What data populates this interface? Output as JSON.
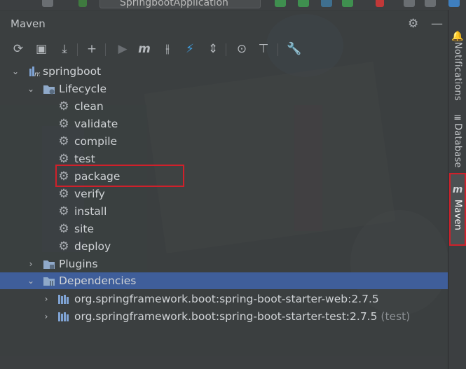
{
  "top_bar": {
    "run_config_label": "SpringbootApplication"
  },
  "panel": {
    "title": "Maven"
  },
  "toolbar": {
    "items": [
      {
        "name": "reload-all-maven-projects",
        "icon": "refresh-icon"
      },
      {
        "name": "generate-sources",
        "icon": "folder-refresh-icon"
      },
      {
        "name": "download-sources",
        "icon": "download-icon"
      },
      {
        "name": "add-maven-project",
        "icon": "plus-icon"
      },
      {
        "name": "run-maven-build",
        "icon": "run-icon"
      },
      {
        "name": "execute-maven-goal",
        "icon": "maven-m-icon"
      },
      {
        "name": "toggle-offline-mode",
        "icon": "offline-icon"
      },
      {
        "name": "skip-tests",
        "icon": "lightning-icon"
      },
      {
        "name": "collapse-all",
        "icon": "collapse-icon"
      },
      {
        "name": "analyze-dependencies",
        "icon": "analyze-icon"
      },
      {
        "name": "show-dependencies",
        "icon": "diagram-icon"
      },
      {
        "name": "maven-settings",
        "icon": "wrench-icon"
      }
    ]
  },
  "tree": {
    "project": "springboot",
    "lifecycle": {
      "label": "Lifecycle",
      "goals": [
        "clean",
        "validate",
        "compile",
        "test",
        "package",
        "verify",
        "install",
        "site",
        "deploy"
      ]
    },
    "plugins": "Plugins",
    "dependencies": {
      "label": "Dependencies",
      "items": [
        {
          "label": "org.springframework.boot:spring-boot-starter-web:2.7.5",
          "scope": ""
        },
        {
          "label": "org.springframework.boot:spring-boot-starter-test:2.7.5",
          "scope": "(test)"
        }
      ]
    }
  },
  "right_stripe": {
    "tabs": [
      "Notifications",
      "Database",
      "Maven"
    ]
  },
  "colors": {
    "selection": "#3f5e9a",
    "highlight": "#d0202a"
  }
}
